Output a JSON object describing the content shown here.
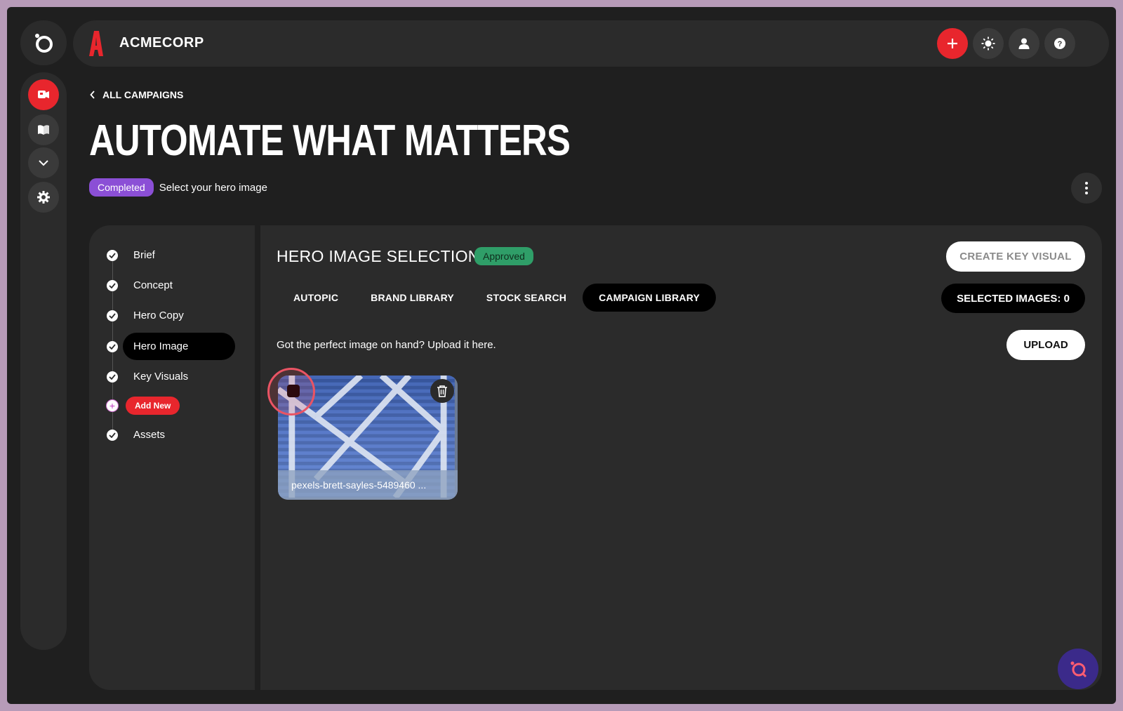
{
  "app": {
    "brand_name": "ACMECORP"
  },
  "header": {
    "breadcrumb": "ALL CAMPAIGNS",
    "title": "AUTOMATE WHAT MATTERS",
    "status_badge": "Completed",
    "status_text": "Select your hero image"
  },
  "steps": [
    {
      "label": "Brief",
      "done": true
    },
    {
      "label": "Concept",
      "done": true
    },
    {
      "label": "Hero Copy",
      "done": true
    },
    {
      "label": "Hero Image",
      "done": true,
      "active": true
    },
    {
      "label": "Key Visuals",
      "done": true
    },
    {
      "label": "Add New",
      "action": true
    },
    {
      "label": "Assets",
      "done": true
    }
  ],
  "main": {
    "section_title": "HERO IMAGE SELECTION",
    "approved_badge": "Approved",
    "create_button": "CREATE KEY VISUAL",
    "tabs": [
      {
        "label": "AUTOPIC"
      },
      {
        "label": "BRAND LIBRARY"
      },
      {
        "label": "STOCK SEARCH"
      },
      {
        "label": "CAMPAIGN LIBRARY",
        "active": true
      }
    ],
    "selected_images": "SELECTED IMAGES: 0",
    "upload_hint": "Got the perfect image on hand? Upload it here.",
    "upload_button": "UPLOAD",
    "images": [
      {
        "caption": "pexels-brett-sayles-5489460 ..."
      }
    ]
  },
  "colors": {
    "accent_red": "#e8262d",
    "completed_purple": "#8b4fd6",
    "approved_green": "#2f9e68",
    "background": "#1f1f1f",
    "panel": "#2b2b2b"
  },
  "icons": {
    "rail": [
      "campaign-icon",
      "book-icon",
      "chevron-down-icon",
      "gear-icon"
    ],
    "top": [
      "plus-icon",
      "sun-icon",
      "user-icon",
      "help-icon"
    ]
  }
}
